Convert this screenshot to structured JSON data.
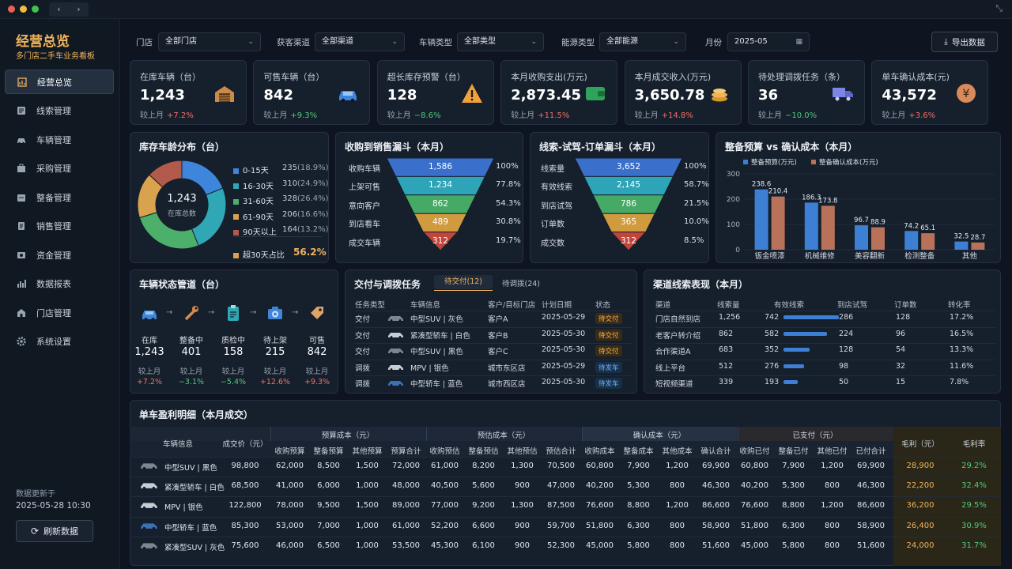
{
  "sidebar": {
    "brand": "经营总览",
    "subtitle": "多门店二手车业务看板",
    "items": [
      {
        "label": "经营总览",
        "icon": "dashboard-icon"
      },
      {
        "label": "线索管理",
        "icon": "leads-icon"
      },
      {
        "label": "车辆管理",
        "icon": "car-icon"
      },
      {
        "label": "采购管理",
        "icon": "purchase-icon"
      },
      {
        "label": "整备管理",
        "icon": "prep-icon"
      },
      {
        "label": "销售管理",
        "icon": "sales-icon"
      },
      {
        "label": "资金管理",
        "icon": "finance-icon"
      },
      {
        "label": "数据报表",
        "icon": "report-icon"
      },
      {
        "label": "门店管理",
        "icon": "store-icon"
      },
      {
        "label": "系统设置",
        "icon": "gear-icon"
      }
    ],
    "updated_label": "数据更新于",
    "updated_value": "2025-05-28 10:30",
    "refresh": "刷新数据"
  },
  "filters": {
    "store_label": "门店",
    "store_value": "全部门店",
    "channel_label": "获客渠道",
    "channel_value": "全部渠道",
    "type_label": "车辆类型",
    "type_value": "全部类型",
    "energy_label": "能源类型",
    "energy_value": "全部能源",
    "month_label": "月份",
    "month_value": "2025-05",
    "export": "导出数据"
  },
  "kpis": [
    {
      "title": "在库车辆（台）",
      "value": "1,243",
      "cmp": "较上月",
      "delta": "+7.2%",
      "dir": "up",
      "icon": "garage-icon"
    },
    {
      "title": "可售车辆（台）",
      "value": "842",
      "cmp": "较上月",
      "delta": "+9.3%",
      "dir": "dn",
      "icon": "car-icon"
    },
    {
      "title": "超长库存预警（台）",
      "value": "128",
      "cmp": "较上月",
      "delta": "−8.6%",
      "dir": "dn",
      "icon": "warning-icon"
    },
    {
      "title": "本月收购支出(万元)",
      "value": "2,873.45",
      "cmp": "较上月",
      "delta": "+11.5%",
      "dir": "up",
      "icon": "wallet-icon"
    },
    {
      "title": "本月成交收入(万元)",
      "value": "3,650.78",
      "cmp": "较上月",
      "delta": "+14.8%",
      "dir": "up",
      "icon": "coins-icon"
    },
    {
      "title": "待处理调拨任务（条）",
      "value": "36",
      "cmp": "较上月",
      "delta": "−10.0%",
      "dir": "dn",
      "icon": "truck-icon"
    },
    {
      "title": "单车确认成本(元)",
      "value": "43,572",
      "cmp": "较上月",
      "delta": "+3.6%",
      "dir": "up",
      "icon": "yen-icon"
    }
  ],
  "age": {
    "title": "库存车龄分布（台）",
    "center_value": "1,243",
    "center_label": "在库总数",
    "segments": [
      {
        "label": "0-15天",
        "value": 235,
        "pct": "(18.9%)",
        "color": "#3d86dc"
      },
      {
        "label": "16-30天",
        "value": 310,
        "pct": "(24.9%)",
        "color": "#2fa7b5"
      },
      {
        "label": "31-60天",
        "value": 328,
        "pct": "(26.4%)",
        "color": "#4caf6a"
      },
      {
        "label": "61-90天",
        "value": 206,
        "pct": "(16.6%)",
        "color": "#d9a24e"
      },
      {
        "label": "90天以上",
        "value": 164,
        "pct": "(13.2%)",
        "color": "#b25a4b"
      }
    ],
    "over30_label": "超30天占比",
    "over30_value": "56.2%"
  },
  "funnel1": {
    "title": "收购到销售漏斗（本月）",
    "rows": [
      {
        "label": "收购车辆",
        "value": "1,586",
        "pct": "100%"
      },
      {
        "label": "上架可售",
        "value": "1,234",
        "pct": "77.8%"
      },
      {
        "label": "意向客户",
        "value": "862",
        "pct": "54.3%"
      },
      {
        "label": "到店看车",
        "value": "489",
        "pct": "30.8%"
      },
      {
        "label": "成交车辆",
        "value": "312",
        "pct": "19.7%"
      }
    ]
  },
  "funnel2": {
    "title": "线索-试驾-订单漏斗（本月）",
    "rows": [
      {
        "label": "线索量",
        "value": "3,652",
        "pct": "100%"
      },
      {
        "label": "有效线索",
        "value": "2,145",
        "pct": "58.7%"
      },
      {
        "label": "到店试驾",
        "value": "786",
        "pct": "21.5%"
      },
      {
        "label": "订单数",
        "value": "365",
        "pct": "10.0%"
      },
      {
        "label": "成交数",
        "value": "312",
        "pct": "8.5%"
      }
    ]
  },
  "chart_data": {
    "type": "bar",
    "title": "整备预算 vs 确认成本（本月）",
    "categories": [
      "钣金喷漆",
      "机械维修",
      "美容翻新",
      "检测整备",
      "其他"
    ],
    "series": [
      {
        "name": "整备预算(万元)",
        "values": [
          238.6,
          186.3,
          96.7,
          74.2,
          32.5
        ],
        "color": "#3d7fd4"
      },
      {
        "name": "整备确认成本(万元)",
        "values": [
          210.4,
          173.8,
          88.9,
          65.1,
          28.7
        ],
        "color": "#b9725a"
      }
    ],
    "ylim": [
      0,
      300
    ],
    "yticks": [
      "0",
      "100",
      "200",
      "300"
    ],
    "legend": "top-left",
    "grid": true
  },
  "pipeline": {
    "title": "车辆状态管道（台）",
    "stages": [
      {
        "label": "在库",
        "value": "1,243",
        "cmp": "较上月",
        "delta": "+7.2%",
        "dir": "up",
        "icon": "car-icon"
      },
      {
        "label": "整备中",
        "value": "401",
        "cmp": "较上月",
        "delta": "−3.1%",
        "dir": "dn",
        "icon": "wrench-icon"
      },
      {
        "label": "质检中",
        "value": "158",
        "cmp": "较上月",
        "delta": "−5.4%",
        "dir": "dn",
        "icon": "clipboard-icon"
      },
      {
        "label": "待上架",
        "value": "215",
        "cmp": "较上月",
        "delta": "+12.6%",
        "dir": "up",
        "icon": "camera-icon"
      },
      {
        "label": "可售",
        "value": "842",
        "cmp": "较上月",
        "delta": "+9.3%",
        "dir": "up",
        "icon": "price-tag-icon"
      }
    ]
  },
  "tasks": {
    "title": "交付与调拨任务",
    "tab1": "待交付(12)",
    "tab2": "待调拨(24)",
    "headers": [
      "任务类型",
      "车辆信息",
      "客户/目标门店",
      "计划日期",
      "状态"
    ],
    "rows": [
      [
        "交付",
        "中型SUV | 灰色",
        "客户A",
        "2025-05-29",
        "待交付"
      ],
      [
        "交付",
        "紧凑型轿车 | 白色",
        "客户B",
        "2025-05-30",
        "待交付"
      ],
      [
        "交付",
        "中型SUV | 黑色",
        "客户C",
        "2025-05-30",
        "待交付"
      ],
      [
        "调拨",
        "MPV | 银色",
        "城市东区店",
        "2025-05-29",
        "待发车"
      ],
      [
        "调拨",
        "中型轿车 | 蓝色",
        "城市西区店",
        "2025-05-30",
        "待发车"
      ]
    ]
  },
  "channels": {
    "title": "渠道线索表现（本月）",
    "headers": [
      "渠道",
      "线索量",
      "有效线索",
      "到店试驾",
      "订单数",
      "转化率"
    ],
    "rows": [
      [
        "门店自然到店",
        "1,256",
        "742",
        "286",
        "128",
        "17.2%"
      ],
      [
        "老客户转介绍",
        "862",
        "582",
        "224",
        "96",
        "16.5%"
      ],
      [
        "合作渠道A",
        "683",
        "352",
        "128",
        "54",
        "13.3%"
      ],
      [
        "线上平台",
        "512",
        "276",
        "98",
        "32",
        "11.6%"
      ],
      [
        "短视频渠道",
        "339",
        "193",
        "50",
        "15",
        "7.8%"
      ]
    ]
  },
  "profit": {
    "title": "单车盈利明细（本月成交）",
    "h_vehicle": "车辆信息",
    "h_price": "成交价（元）",
    "groups": [
      "预算成本（元）",
      "预估成本（元）",
      "确认成本（元）",
      "已支付（元）"
    ],
    "sub": [
      "收购预算",
      "整备预算",
      "其他预算",
      "预算合计",
      "收购预估",
      "整备预估",
      "其他预估",
      "预估合计",
      "收购成本",
      "整备成本",
      "其他成本",
      "确认合计",
      "收购已付",
      "整备已付",
      "其他已付",
      "已付合计"
    ],
    "h_gross": "毛利（元）",
    "h_margin": "毛利率",
    "rows": [
      {
        "vehicle": "中型SUV | 黑色",
        "vals": [
          "98,800",
          "62,000",
          "8,500",
          "1,500",
          "72,000",
          "61,000",
          "8,200",
          "1,300",
          "70,500",
          "60,800",
          "7,900",
          "1,200",
          "69,900",
          "60,800",
          "7,900",
          "1,200",
          "69,900"
        ],
        "gross": "28,900",
        "margin": "29.2%"
      },
      {
        "vehicle": "紧凑型轿车 | 白色",
        "vals": [
          "68,500",
          "41,000",
          "6,000",
          "1,000",
          "48,000",
          "40,500",
          "5,600",
          "900",
          "47,000",
          "40,200",
          "5,300",
          "800",
          "46,300",
          "40,200",
          "5,300",
          "800",
          "46,300"
        ],
        "gross": "22,200",
        "margin": "32.4%"
      },
      {
        "vehicle": "MPV | 银色",
        "vals": [
          "122,800",
          "78,000",
          "9,500",
          "1,500",
          "89,000",
          "77,000",
          "9,200",
          "1,300",
          "87,500",
          "76,600",
          "8,800",
          "1,200",
          "86,600",
          "76,600",
          "8,800",
          "1,200",
          "86,600"
        ],
        "gross": "36,200",
        "margin": "29.5%"
      },
      {
        "vehicle": "中型轿车 | 蓝色",
        "vals": [
          "85,300",
          "53,000",
          "7,000",
          "1,000",
          "61,000",
          "52,200",
          "6,600",
          "900",
          "59,700",
          "51,800",
          "6,300",
          "800",
          "58,900",
          "51,800",
          "6,300",
          "800",
          "58,900"
        ],
        "gross": "26,400",
        "margin": "30.9%"
      },
      {
        "vehicle": "紧凑型SUV | 灰色",
        "vals": [
          "75,600",
          "46,000",
          "6,500",
          "1,000",
          "53,500",
          "45,300",
          "6,100",
          "900",
          "52,300",
          "45,000",
          "5,800",
          "800",
          "51,600",
          "45,000",
          "5,800",
          "800",
          "51,600"
        ],
        "gross": "24,000",
        "margin": "31.7%"
      }
    ]
  }
}
